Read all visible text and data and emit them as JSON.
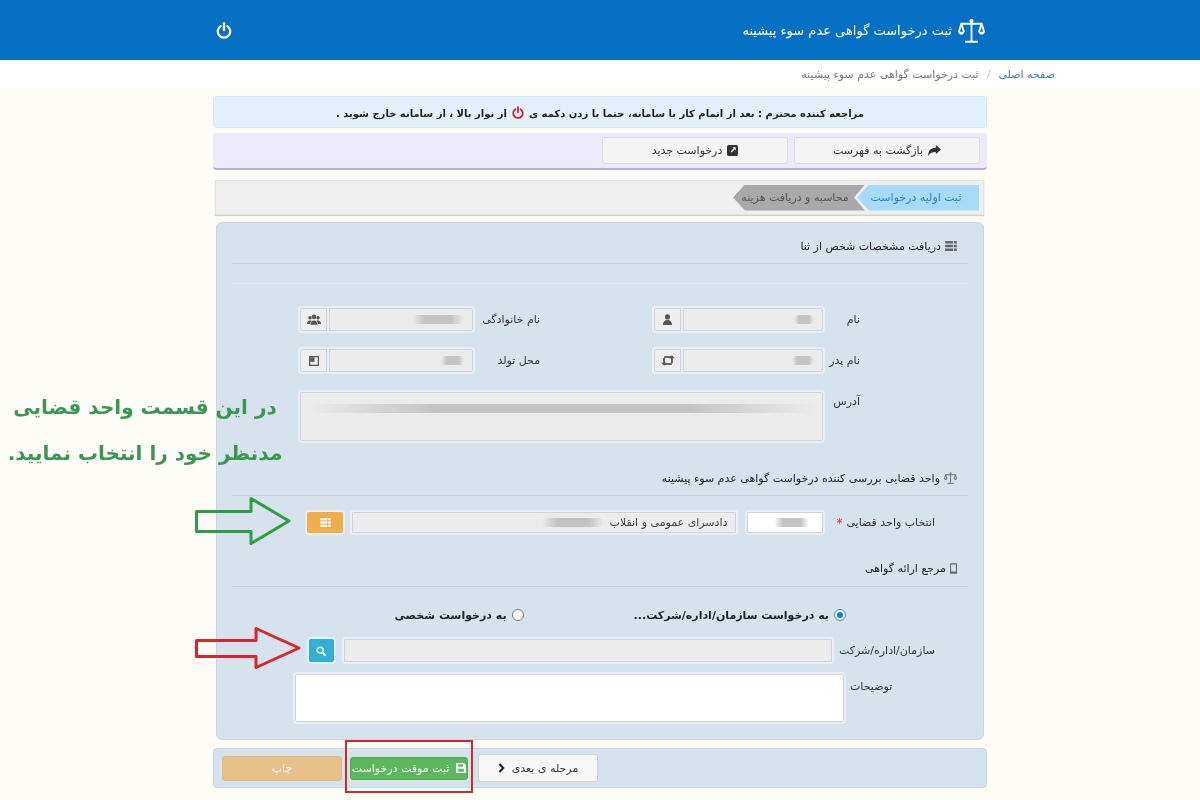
{
  "header": {
    "title": "ثبت درخواست گواهی عدم سوء پیشینه"
  },
  "breadcrumb": {
    "separator": "/",
    "items": [
      {
        "label": "صفحه اصلی",
        "kind": "link"
      },
      {
        "label": "ثبت درخواست گواهی عدم سوء پیشینه",
        "kind": "current"
      }
    ]
  },
  "notice": {
    "text_before": "مراجعه کننده محترم : بعد از اتمام کار با سامانه، حتما با زدن دکمه ی",
    "text_after": "از نوار بالا ، از سامانه خارج شوید ."
  },
  "toolbar": {
    "buttons": [
      {
        "label": "بازگشت به فهرست"
      },
      {
        "label": "درخواست جدید"
      }
    ]
  },
  "steps": [
    {
      "label": "ثبت اولیه درخواست",
      "selected": true
    },
    {
      "label": "محاسبه و دریافت هزینه",
      "selected": false
    }
  ],
  "sections": [
    {
      "title": "دریافت مشخصات شخص از ثنا",
      "fields": [
        {
          "kind": "addon-input",
          "label": "نام",
          "readonly": true,
          "redacted": true
        },
        {
          "kind": "addon-input",
          "label": "نام خانوادگی",
          "readonly": true,
          "redacted": true
        },
        {
          "kind": "addon-input",
          "label": "نام پدر",
          "readonly": true,
          "redacted": true
        },
        {
          "kind": "addon-input",
          "label": "محل تولد",
          "readonly": true,
          "redacted": true
        },
        {
          "kind": "textarea",
          "label": "آدرس",
          "readonly": true,
          "redacted": true
        }
      ]
    },
    {
      "title": "واحد قضایی بررسی کننده درخواست گواهی عدم سوء پیشینه",
      "fields": [
        {
          "kind": "unit-picker",
          "label": "انتخاب واحد قضایی",
          "required_mark": "*",
          "code_redacted": true,
          "value": "دادسرای عمومی و انقلاب",
          "value_redacted": true,
          "readonly": true
        }
      ]
    },
    {
      "title": "مرجع ارائه گواهی",
      "radios": [
        {
          "label": "به درخواست سازمان/اداره/شرکت...",
          "selected": true
        },
        {
          "label": "به درخواست شخصی",
          "selected": false
        }
      ],
      "fields": [
        {
          "kind": "search-input",
          "label": "سازمان/اداره/شرکت",
          "readonly": true
        },
        {
          "kind": "textarea",
          "label": "توضیحات",
          "readonly": false
        }
      ]
    }
  ],
  "actions": [
    {
      "label": "مرحله ی بعدی",
      "kind": "next",
      "disabled": false
    },
    {
      "label": "ثبت موقت درخواست",
      "kind": "save",
      "disabled": false
    },
    {
      "label": "چاپ",
      "kind": "print",
      "disabled": true
    }
  ],
  "annotation": {
    "lines": [
      "در این قسمت واحد قضایی",
      "مدنظر خود را انتخاب نمایید."
    ],
    "arrows": [
      {
        "color": "#2e9d46"
      },
      {
        "color": "#d7262f"
      }
    ]
  }
}
